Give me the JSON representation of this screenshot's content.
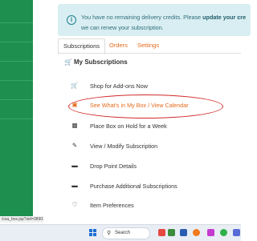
{
  "notice": {
    "line1_prefix": "You have no remaining delivery credits. Please ",
    "line1_bold": "update your cre",
    "line2": "we can renew your subscription."
  },
  "tabs": [
    {
      "label": "Subscriptions",
      "active": true
    },
    {
      "label": "Orders",
      "active": false
    },
    {
      "label": "Settings",
      "active": false
    }
  ],
  "section": {
    "title": "My Subscriptions",
    "icon": "cart-icon"
  },
  "menu_items": [
    {
      "label": "Shop for Add-ons Now",
      "icon": "cart-icon"
    },
    {
      "label": "See What's in My Box / View Calendar",
      "icon": "calendar-icon",
      "highlighted": true
    },
    {
      "label": "Place Box on Hold for a Week",
      "icon": "calendar-x-icon"
    },
    {
      "label": "View / Modify Subscription",
      "icon": "pencil-icon"
    },
    {
      "label": "Drop Point Details",
      "icon": "card-icon"
    },
    {
      "label": "Purchase Additional Subscriptions",
      "icon": "card-icon"
    },
    {
      "label": "Item Preferences",
      "icon": "heart-icon"
    }
  ],
  "status_bar": {
    "url": "/csa_box.jsp?sid=389032"
  },
  "taskbar": {
    "search_placeholder": "Search"
  },
  "colors": {
    "accent": "#e46a1c",
    "sidebar": "#1e8f4e",
    "notice_bg": "#d9eef2",
    "annotation": "#d12a2a"
  }
}
